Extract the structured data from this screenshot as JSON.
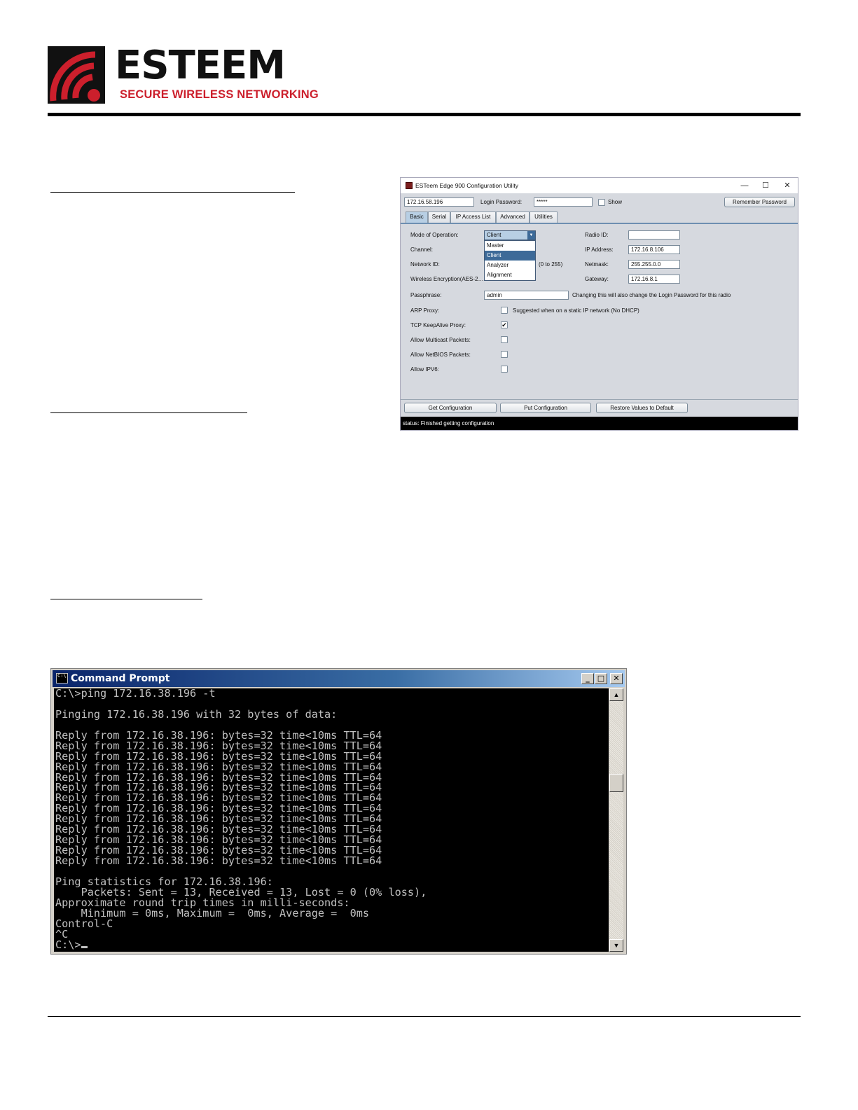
{
  "header": {
    "logo_word": "ESTEEM",
    "logo_tagline": "SECURE WIRELESS NETWORKING"
  },
  "config_utility": {
    "title": "ESTeem Edge 900 Configuration Utility",
    "window_buttons": [
      "—",
      "☐",
      "✕"
    ],
    "ip_field": "172.16.58.196",
    "login_password_label": "Login Password:",
    "login_password_value": "*****",
    "show_label": "Show",
    "remember_password_label": "Remember Password",
    "tabs": [
      "Basic",
      "Serial",
      "IP Access List",
      "Advanced",
      "Utilities"
    ],
    "active_tab": "Basic",
    "fields_left": {
      "mode_label": "Mode of Operation:",
      "mode_value": "Client",
      "channel_label": "Channel:",
      "network_id_label": "Network ID:",
      "network_id_hint": "(0 to 255)",
      "encryption_label": "Wireless Encryption(AES-2…",
      "passphrase_label": "Passphrase:",
      "passphrase_value": "admin",
      "passphrase_note": "Changing this will also change the Login Password for this radio",
      "arp_label": "ARP Proxy:",
      "arp_note": "Suggested when on a static IP network (No DHCP)",
      "arp_checked": false,
      "tcp_label": "TCP KeepAlive Proxy:",
      "tcp_checked": true,
      "multicast_label": "Allow Multicast Packets:",
      "multicast_checked": false,
      "netbios_label": "Allow NetBIOS Packets:",
      "netbios_checked": false,
      "ipv6_label": "Allow IPV6:",
      "ipv6_checked": false
    },
    "mode_options": [
      "Master",
      "Client",
      "Analyzer",
      "Alignment"
    ],
    "fields_right": {
      "radio_id_label": "Radio ID:",
      "radio_id_value": "",
      "ip_label": "IP Address:",
      "ip_value": "172.16.8.106",
      "netmask_label": "Netmask:",
      "netmask_value": "255.255.0.0",
      "gateway_label": "Gateway:",
      "gateway_value": "172.16.8.1"
    },
    "buttons": {
      "get": "Get Configuration",
      "put": "Put Configuration",
      "restore": "Restore Values to Default"
    },
    "status": "status: Finished getting configuration"
  },
  "command_prompt": {
    "title": "Command Prompt",
    "icon_text": "C:\\",
    "lines": [
      "C:\\>ping 172.16.38.196 -t",
      "",
      "Pinging 172.16.38.196 with 32 bytes of data:",
      "",
      "Reply from 172.16.38.196: bytes=32 time<10ms TTL=64",
      "Reply from 172.16.38.196: bytes=32 time<10ms TTL=64",
      "Reply from 172.16.38.196: bytes=32 time<10ms TTL=64",
      "Reply from 172.16.38.196: bytes=32 time<10ms TTL=64",
      "Reply from 172.16.38.196: bytes=32 time<10ms TTL=64",
      "Reply from 172.16.38.196: bytes=32 time<10ms TTL=64",
      "Reply from 172.16.38.196: bytes=32 time<10ms TTL=64",
      "Reply from 172.16.38.196: bytes=32 time<10ms TTL=64",
      "Reply from 172.16.38.196: bytes=32 time<10ms TTL=64",
      "Reply from 172.16.38.196: bytes=32 time<10ms TTL=64",
      "Reply from 172.16.38.196: bytes=32 time<10ms TTL=64",
      "Reply from 172.16.38.196: bytes=32 time<10ms TTL=64",
      "Reply from 172.16.38.196: bytes=32 time<10ms TTL=64",
      "",
      "Ping statistics for 172.16.38.196:",
      "    Packets: Sent = 13, Received = 13, Lost = 0 (0% loss),",
      "Approximate round trip times in milli-seconds:",
      "    Minimum = 0ms, Maximum =  0ms, Average =  0ms",
      "Control-C",
      "^C"
    ],
    "prompt": "C:\\>"
  },
  "colors": {
    "brand_red": "#cc1f2c",
    "logo_black": "#111111",
    "cmd_title_blue": "#0a246a"
  }
}
